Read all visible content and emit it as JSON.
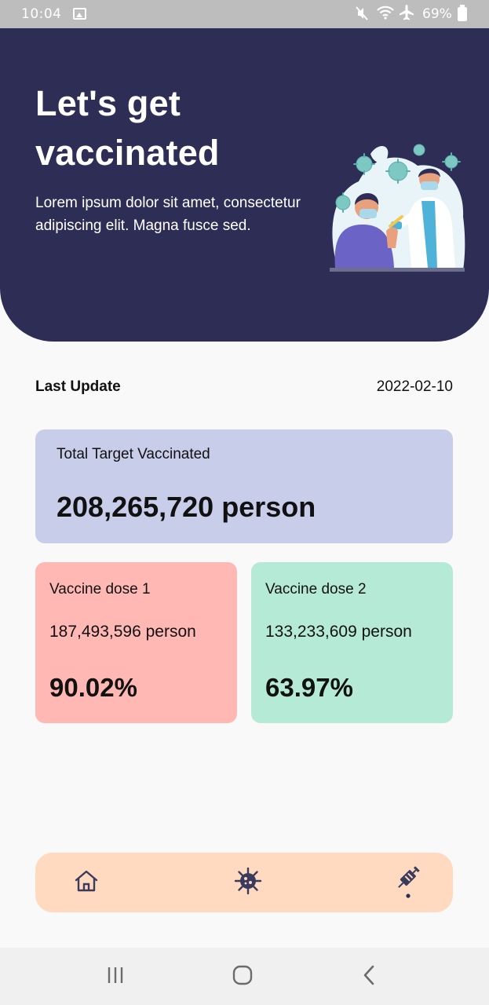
{
  "status_bar": {
    "time": "10:04",
    "battery": "69%",
    "icons": [
      "image-icon",
      "mute-icon",
      "wifi-icon",
      "airplane-mode-icon",
      "battery-icon"
    ]
  },
  "hero": {
    "title": "Let's get vaccinated",
    "description": "Lorem ipsum dolor sit amet, consectetur adipiscing elit. Magna fusce sed.",
    "illustration": "vaccination-illustration"
  },
  "last_update": {
    "label": "Last Update",
    "date": "2022-02-10"
  },
  "total": {
    "label": "Total Target Vaccinated",
    "value": "208,265,720 person"
  },
  "doses": [
    {
      "label": "Vaccine dose 1",
      "count": "187,493,596 person",
      "percent": "90.02%"
    },
    {
      "label": "Vaccine dose 2",
      "count": "133,233,609 person",
      "percent": "63.97%"
    }
  ],
  "bottom_nav": {
    "items": [
      {
        "icon": "home-icon"
      },
      {
        "icon": "virus-icon"
      },
      {
        "icon": "vaccine-syringe-icon",
        "active": true
      }
    ]
  },
  "system_nav": {
    "items": [
      "recents-icon",
      "home-circle-icon",
      "back-icon"
    ]
  },
  "colors": {
    "hero_bg": "#2d2d56",
    "total_card": "#c8cdea",
    "dose1_card": "#ffb8b3",
    "dose2_card": "#b5ead6",
    "bottom_nav_bg": "#ffdac1",
    "icon_color": "#3a3a5c"
  }
}
